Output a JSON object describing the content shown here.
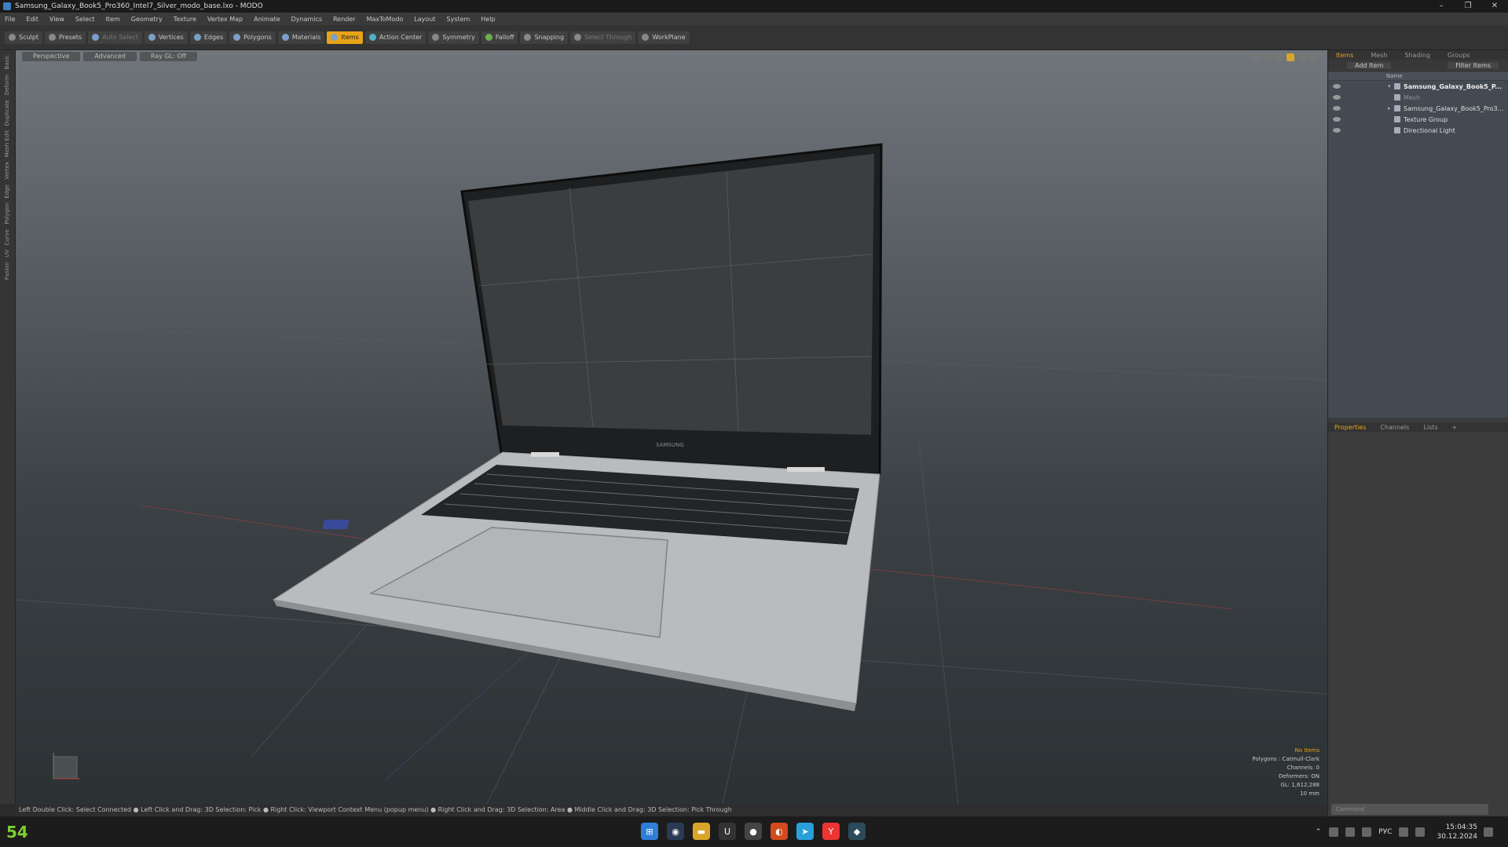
{
  "window": {
    "title": "Samsung_Galaxy_Book5_Pro360_Intel7_Silver_modo_base.lxo - MODO",
    "controls": [
      "–",
      "❐",
      "✕"
    ]
  },
  "menu": [
    "File",
    "Edit",
    "View",
    "Select",
    "Item",
    "Geometry",
    "Texture",
    "Vertex Map",
    "Animate",
    "Dynamics",
    "Render",
    "MaxToModo",
    "Layout",
    "System",
    "Help"
  ],
  "toolbar": {
    "items": [
      {
        "label": "Sculpt",
        "icon": "brush-icon"
      },
      {
        "label": "Presets",
        "icon": "presets-icon"
      },
      {
        "label": "Auto Select",
        "icon": "shield-icon",
        "dim": true
      },
      {
        "label": "Vertices",
        "icon": "shield-icon"
      },
      {
        "label": "Edges",
        "icon": "shield-icon"
      },
      {
        "label": "Polygons",
        "icon": "shield-icon"
      },
      {
        "label": "Materials",
        "icon": "shield-icon"
      },
      {
        "label": "Items",
        "icon": "shield-icon",
        "active": true
      },
      {
        "label": "Action Center",
        "icon": "action-center-icon"
      },
      {
        "label": "Symmetry",
        "icon": "symmetry-icon"
      },
      {
        "label": "Falloff",
        "icon": "falloff-icon"
      },
      {
        "label": "Snapping",
        "icon": "snapping-icon"
      },
      {
        "label": "Select Through",
        "icon": "select-through-icon",
        "dim": true
      },
      {
        "label": "WorkPlane",
        "icon": "workplane-icon"
      }
    ]
  },
  "left_tools": [
    "Basic",
    "Deform",
    "Duplicate",
    "Mesh Edit",
    "Vertex",
    "Edge",
    "Polygon",
    "Curve",
    "UV",
    "Fusion"
  ],
  "viewport": {
    "tabs": [
      "Perspective",
      "Advanced",
      "Ray GL: Off"
    ],
    "info": {
      "selection": "No Items",
      "polygons": "Polygons : Catmull-Clark",
      "channels": "Channels: 0",
      "deformers": "Deformers: ON",
      "gl": "GL: 1,612,288",
      "scale": "10 mm"
    },
    "screen_logo": "SAMSUNG"
  },
  "statusbar": "Left Double Click: Select Connected ● Left Click and Drag: 3D Selection: Pick ● Right Click: Viewport Context Menu (popup menu) ● Right Click and Drag: 3D Selection: Area ● Middle Click and Drag: 3D Selection: Pick Through",
  "items_panel": {
    "tabs": [
      "Items",
      "Mesh",
      "Shading",
      "Groups"
    ],
    "add_item": "Add Item",
    "filter": "Filter Items",
    "col_name": "Name",
    "tree": [
      {
        "label": "Samsung_Galaxy_Book5_P...",
        "style": "bold"
      },
      {
        "label": "Mesh",
        "style": "faint"
      },
      {
        "label": "Samsung_Galaxy_Book5_Pro3...",
        "style": "normal"
      },
      {
        "label": "Texture Group",
        "style": "normal"
      },
      {
        "label": "Directional Light",
        "style": "normal"
      }
    ]
  },
  "properties_panel": {
    "tabs": [
      "Properties",
      "Channels",
      "Lists",
      "+"
    ]
  },
  "command_placeholder": "Command",
  "taskbar": {
    "fps": "54",
    "lang": "РУС",
    "time": "15:04:35",
    "date": "30.12.2024"
  }
}
